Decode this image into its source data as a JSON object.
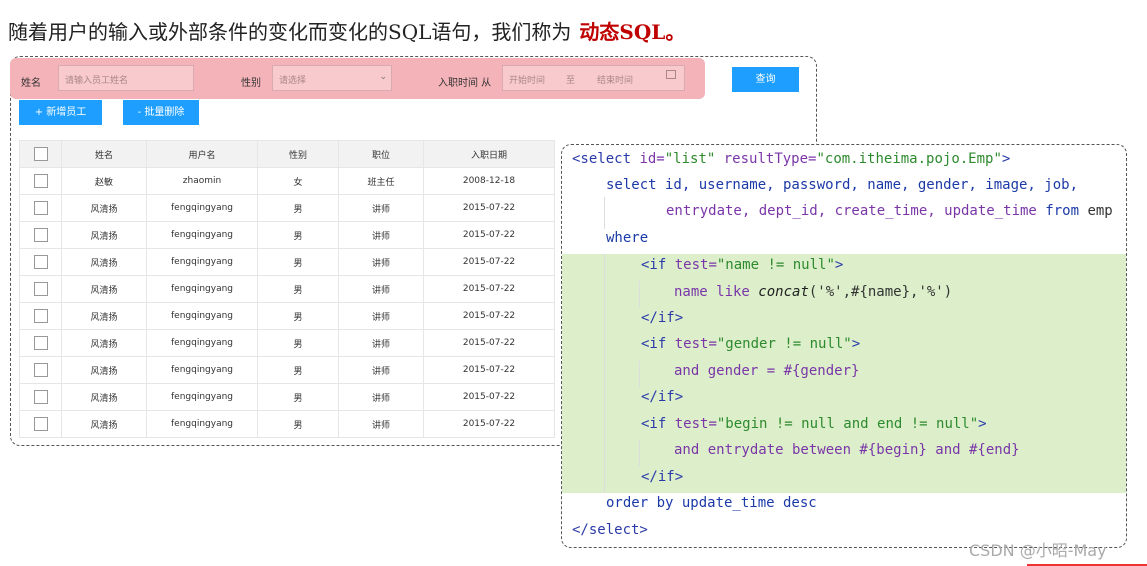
{
  "heading": {
    "text": "随着用户的输入或外部条件的变化而变化的SQL语句，我们称为",
    "highlight": "动态SQL。"
  },
  "filter": {
    "name_label": "姓名",
    "name_placeholder": "请输入员工姓名",
    "gender_label": "性别",
    "gender_placeholder": "请选择",
    "date_label": "入职时间 从",
    "date_start": "开始时间",
    "date_sep": "至",
    "date_end": "结束时间",
    "query_button": "查询"
  },
  "actions": {
    "add": "+ 新增员工",
    "batch_delete": "- 批量删除"
  },
  "table": {
    "headers": [
      "姓名",
      "用户名",
      "性别",
      "职位",
      "入职日期"
    ],
    "rows": [
      [
        "赵敏",
        "zhaomin",
        "女",
        "班主任",
        "2008-12-18"
      ],
      [
        "风清扬",
        "fengqingyang",
        "男",
        "讲师",
        "2015-07-22"
      ],
      [
        "风清扬",
        "fengqingyang",
        "男",
        "讲师",
        "2015-07-22"
      ],
      [
        "风清扬",
        "fengqingyang",
        "男",
        "讲师",
        "2015-07-22"
      ],
      [
        "风清扬",
        "fengqingyang",
        "男",
        "讲师",
        "2015-07-22"
      ],
      [
        "风清扬",
        "fengqingyang",
        "男",
        "讲师",
        "2015-07-22"
      ],
      [
        "风清扬",
        "fengqingyang",
        "男",
        "讲师",
        "2015-07-22"
      ],
      [
        "风清扬",
        "fengqingyang",
        "男",
        "讲师",
        "2015-07-22"
      ],
      [
        "风清扬",
        "fengqingyang",
        "男",
        "讲师",
        "2015-07-22"
      ],
      [
        "风清扬",
        "fengqingyang",
        "男",
        "讲师",
        "2015-07-22"
      ]
    ]
  },
  "code": {
    "l1_tag": "<select",
    "l1_a1": " id=",
    "l1_v1": "\"list\"",
    "l1_a2": " resultType=",
    "l1_v2": "\"com.itheima.pojo.Emp\"",
    "l1_end": ">",
    "l2": "select id, username, password, name, gender, image, job,",
    "l3_a": "entrydate, dept_id, create_time, update_time ",
    "l3_from": "from",
    "l3_b": " emp",
    "l4": "where",
    "if1_tag": "<if",
    "if1_a": " test=",
    "if1_v": "\"name != null\"",
    "if1_end": ">",
    "l6_a": "name like ",
    "l6_fn": "concat",
    "l6_b": "('%',#{name},'%')",
    "endif": "</if>",
    "if2_tag": "<if",
    "if2_a": " test=",
    "if2_v": "\"gender != null\"",
    "if2_end": ">",
    "l9": "and gender = #{gender}",
    "if3_tag": "<if",
    "if3_a": " test=",
    "if3_v": "\"begin != null and end != null\"",
    "if3_end": ">",
    "l12": "and entrydate between #{begin} and #{end}",
    "l14": "order by update_time desc",
    "l15": "</select>"
  },
  "watermark": "CSDN @小昭-May"
}
